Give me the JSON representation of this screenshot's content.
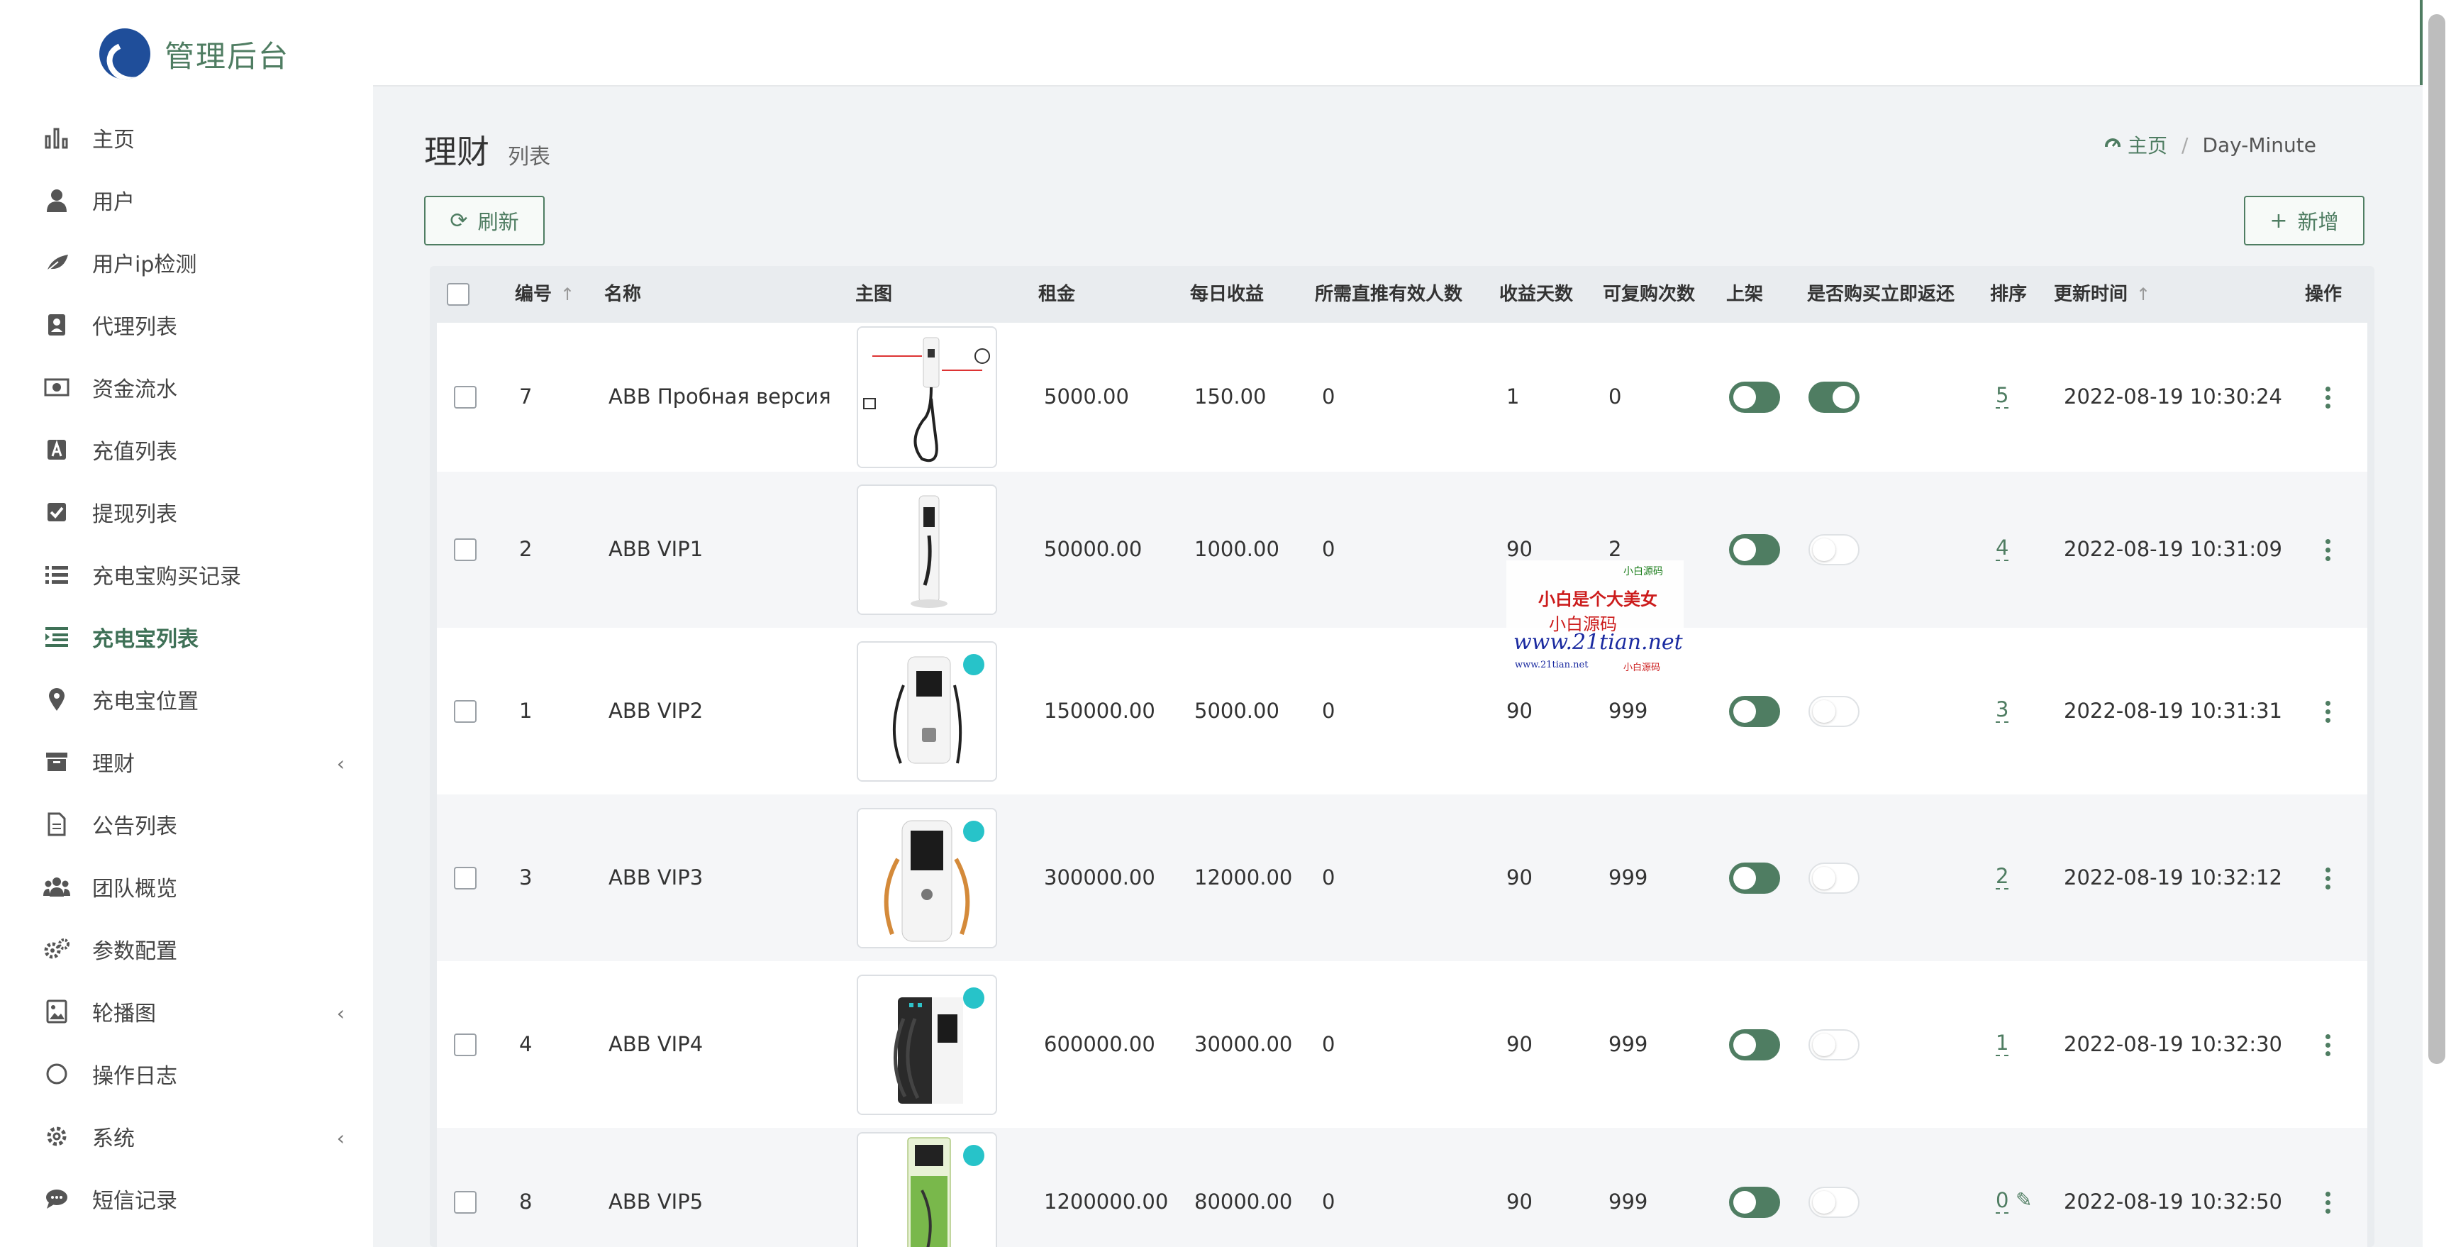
{
  "brand": {
    "name": "管理后台",
    "colors": {
      "accent": "#4f7d62",
      "logo": "#1f4e9a"
    }
  },
  "sidebar": {
    "items": [
      {
        "label": "主页",
        "icon": "bar-chart-icon"
      },
      {
        "label": "用户",
        "icon": "user-icon"
      },
      {
        "label": "用户ip检测",
        "icon": "leaf-icon"
      },
      {
        "label": "代理列表",
        "icon": "contact-card-icon"
      },
      {
        "label": "资金流水",
        "icon": "money-icon"
      },
      {
        "label": "充值列表",
        "icon": "font-box-icon"
      },
      {
        "label": "提现列表",
        "icon": "check-square-icon"
      },
      {
        "label": "充电宝购买记录",
        "icon": "list-icon"
      },
      {
        "label": "充电宝列表",
        "icon": "indent-list-icon",
        "active": true
      },
      {
        "label": "充电宝位置",
        "icon": "map-pin-icon"
      },
      {
        "label": "理财",
        "icon": "archive-icon",
        "chevron": true
      },
      {
        "label": "公告列表",
        "icon": "document-icon"
      },
      {
        "label": "团队概览",
        "icon": "users-icon"
      },
      {
        "label": "参数配置",
        "icon": "gears-icon"
      },
      {
        "label": "轮播图",
        "icon": "image-icon",
        "chevron": true
      },
      {
        "label": "操作日志",
        "icon": "circle-icon"
      },
      {
        "label": "系统",
        "icon": "gear-icon",
        "chevron": true
      },
      {
        "label": "短信记录",
        "icon": "chat-bubble-icon"
      }
    ]
  },
  "page": {
    "title": "理财",
    "subtitle": "列表",
    "breadcrumb": {
      "home": "主页",
      "current": "Day-Minute"
    }
  },
  "toolbar": {
    "refresh_label": "刷新",
    "add_label": "新增"
  },
  "table": {
    "headers": {
      "id": "编号",
      "name": "名称",
      "image": "主图",
      "rent": "租金",
      "daily": "每日收益",
      "referrals": "所需直推有效人数",
      "days": "收益天数",
      "repurchase": "可复购次数",
      "listed": "上架",
      "instant": "是否购买立即返还",
      "sort": "排序",
      "updated": "更新时间",
      "actions": "操作"
    },
    "rows": [
      {
        "id": "7",
        "name": "ABB Пробная версия",
        "rent": "5000.00",
        "daily": "150.00",
        "referrals": "0",
        "days": "1",
        "repurchase": "0",
        "listed": true,
        "instant": true,
        "sort": "5",
        "updated": "2022-08-19 10:30:24"
      },
      {
        "id": "2",
        "name": "ABB VIP1",
        "rent": "50000.00",
        "daily": "1000.00",
        "referrals": "0",
        "days": "90",
        "repurchase": "2",
        "listed": true,
        "instant": false,
        "sort": "4",
        "updated": "2022-08-19 10:31:09"
      },
      {
        "id": "1",
        "name": "ABB VIP2",
        "rent": "150000.00",
        "daily": "5000.00",
        "referrals": "0",
        "days": "90",
        "repurchase": "999",
        "listed": true,
        "instant": false,
        "sort": "3",
        "updated": "2022-08-19 10:31:31"
      },
      {
        "id": "3",
        "name": "ABB VIP3",
        "rent": "300000.00",
        "daily": "12000.00",
        "referrals": "0",
        "days": "90",
        "repurchase": "999",
        "listed": true,
        "instant": false,
        "sort": "2",
        "updated": "2022-08-19 10:32:12"
      },
      {
        "id": "4",
        "name": "ABB VIP4",
        "rent": "600000.00",
        "daily": "30000.00",
        "referrals": "0",
        "days": "90",
        "repurchase": "999",
        "listed": true,
        "instant": false,
        "sort": "1",
        "updated": "2022-08-19 10:32:30"
      },
      {
        "id": "8",
        "name": "ABB VIP5",
        "rent": "1200000.00",
        "daily": "80000.00",
        "referrals": "0",
        "days": "90",
        "repurchase": "999",
        "listed": true,
        "instant": false,
        "sort": "0",
        "updated": "2022-08-19 10:32:50"
      }
    ]
  },
  "watermark": {
    "line1": "小白是个大美女",
    "line2": "小白源码",
    "line3": "www.21tian.net",
    "small1": "小白源码",
    "small2": "www.21tian.net",
    "small3": "小白源码"
  }
}
